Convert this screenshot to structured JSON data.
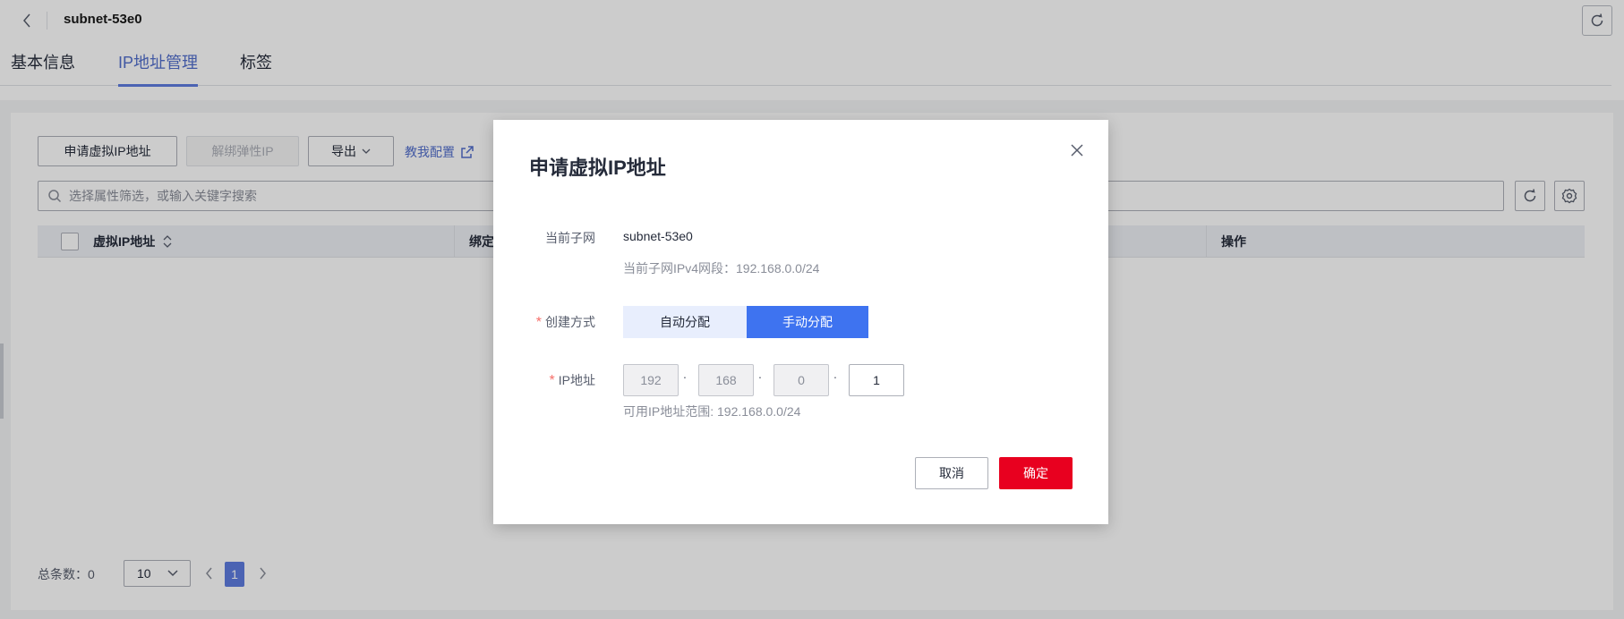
{
  "header": {
    "title": "subnet-53e0"
  },
  "tabs": [
    {
      "label": "基本信息",
      "active": false
    },
    {
      "label": "IP地址管理",
      "active": true
    },
    {
      "label": "标签",
      "active": false
    }
  ],
  "toolbar": {
    "apply_vip_label": "申请虚拟IP地址",
    "unbind_eip_label": "解绑弹性IP",
    "export_label": "导出",
    "help_link_label": "教我配置"
  },
  "search": {
    "placeholder": "选择属性筛选，或输入关键字搜索",
    "value": ""
  },
  "table": {
    "columns": [
      "虚拟IP地址",
      "绑定",
      "操作"
    ],
    "rows": []
  },
  "pagination": {
    "total_text": "总条数：0",
    "page_size": "10",
    "current_page": "1"
  },
  "dialog": {
    "title": "申请虚拟IP地址",
    "current_subnet_label": "当前子网",
    "current_subnet_value": "subnet-53e0",
    "ipv4_range_hint": "当前子网IPv4网段：192.168.0.0/24",
    "create_method_label": "创建方式",
    "create_method_options": [
      "自动分配",
      "手动分配"
    ],
    "create_method_selected": "手动分配",
    "ip_label": "IP地址",
    "ip_octets": [
      "192",
      "168",
      "0",
      "1"
    ],
    "ip_range_hint": "可用IP地址范围: 192.168.0.0/24",
    "cancel_label": "取消",
    "confirm_label": "确定"
  },
  "colors": {
    "accent": "#5e7ce0",
    "selected_segment": "#3e73f0",
    "confirm_button": "#e8001f",
    "required_mark": "#f66f6a"
  },
  "icons": [
    "back-icon",
    "refresh-icon",
    "chevron-down-icon",
    "external-link-icon",
    "search-icon",
    "gear-icon",
    "sort-icon",
    "chevron-left-icon",
    "chevron-right-icon",
    "close-icon"
  ]
}
